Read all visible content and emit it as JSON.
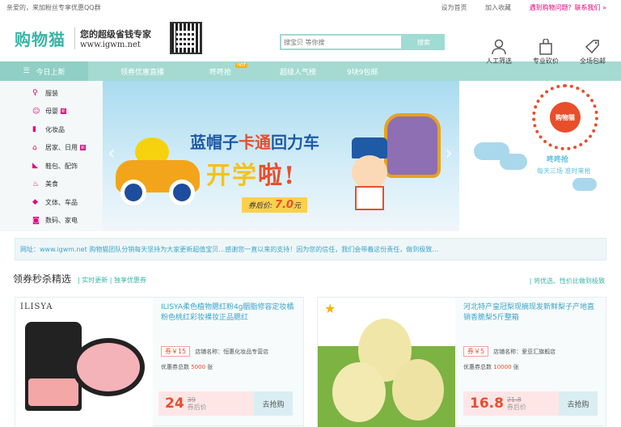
{
  "topbar": {
    "greeting": "亲爱的，来加粉丝专享优惠QQ群",
    "set_home": "设为首页",
    "add_fav": "加入收藏",
    "help": "遇到购物问题？联系我们 »"
  },
  "header": {
    "logo": "购物猫",
    "slogan1": "您的超级省钱专家",
    "slogan2": "www.igwm.net",
    "search_placeholder": "搜宝贝 等你搜",
    "search_button": "搜索",
    "icons": [
      {
        "icon": "user-icon",
        "label": "人工筛选"
      },
      {
        "icon": "bag-icon",
        "label": "专业砍价"
      },
      {
        "icon": "tag-icon",
        "label": "全场包邮"
      }
    ]
  },
  "nav": {
    "category_label": "今日上新",
    "items": [
      "领券优惠直播",
      "咚咚抢",
      "超级人气榜",
      "9块9包邮"
    ],
    "hot_badge": "HOT"
  },
  "sidebar": {
    "items": [
      {
        "icon": "dress-icon",
        "label": "服装",
        "new": false
      },
      {
        "icon": "baby-icon",
        "label": "母婴",
        "new": true
      },
      {
        "icon": "cosmetics-icon",
        "label": "化妆品",
        "new": false
      },
      {
        "icon": "home-icon",
        "label": "居家、日用",
        "new": true
      },
      {
        "icon": "shoe-icon",
        "label": "鞋包、配饰",
        "new": false
      },
      {
        "icon": "food-icon",
        "label": "美食",
        "new": false
      },
      {
        "icon": "car-icon",
        "label": "文体、车品",
        "new": false
      },
      {
        "icon": "camera-icon",
        "label": "数码、家电",
        "new": false
      }
    ],
    "new_badge": "新"
  },
  "banner": {
    "title1a": "蓝帽子",
    "title1b": "卡通",
    "title1c": "回力车",
    "title2a": "开学",
    "title2b": "啦!",
    "price_label": "券后价:",
    "price_value": "7.0",
    "price_unit": "元"
  },
  "promo": {
    "circle_text": "购物猫",
    "sub1": "咚咚抢",
    "sub2": "每天三场 准时来抢"
  },
  "notice": "网址：www.igwm.net 购物猫团队分销每天坚持为大家更新超值宝贝…感谢您一直以来的支持！因为您的信任，我们会带着这份责任，做到极致…",
  "section": {
    "title": "领券秒杀精选",
    "sub": "| 实时更新 | 独享优惠券",
    "right": "| 将优选、性价比做到极致"
  },
  "products": [
    {
      "brand": "ILISYA",
      "title": "ILISYA柔色植物腮红粉4g胭脂修容定妆橘粉色桃红彩妆裸妆正品腮红",
      "coupon": "券￥15",
      "shop_label": "店铺名称：",
      "shop": "恒惠化妆品专营店",
      "left_label": "优惠券总数",
      "left": "5000",
      "left_unit": "张",
      "price": "24",
      "old_price": "39",
      "price_note": "券后价",
      "buy": "去抢购"
    },
    {
      "brand": "",
      "title": "河北特产皇冠梨现摘现发新鲜梨子产地直销香脆梨5斤整箱",
      "coupon": "券￥5",
      "shop_label": "店铺名称：",
      "shop": "爱亚汇旗舰店",
      "left_label": "优惠券总数",
      "left": "10000",
      "left_unit": "张",
      "price": "16.8",
      "old_price": "21.8",
      "price_note": "券后价",
      "buy": "去抢购"
    }
  ]
}
